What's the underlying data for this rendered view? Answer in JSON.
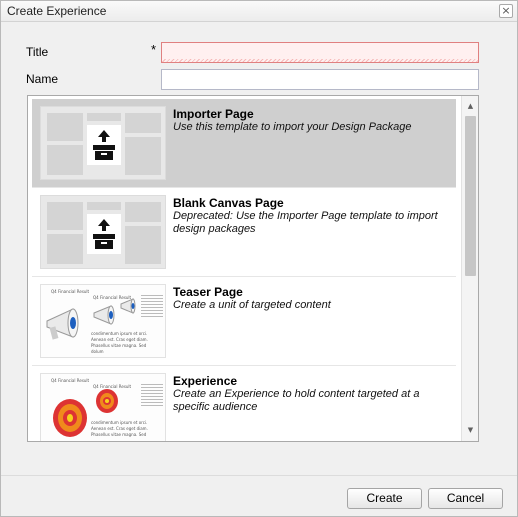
{
  "dialog": {
    "title": "Create Experience",
    "close_glyph": "×"
  },
  "form": {
    "title_label": "Title",
    "required_marker": "*",
    "title_value": "",
    "name_label": "Name",
    "name_value": ""
  },
  "templates": [
    {
      "title": "Importer Page",
      "description": "Use this template to import your Design Package",
      "selected": true,
      "icon": "upload-box-icon"
    },
    {
      "title": "Blank Canvas Page",
      "description": "Deprecated: Use the Importer Page template to import design packages",
      "selected": false,
      "icon": "upload-box-icon"
    },
    {
      "title": "Teaser Page",
      "description": "Create a unit of targeted content",
      "selected": false,
      "icon": "megaphone-icon"
    },
    {
      "title": "Experience",
      "description": "Create an Experience to hold content targeted at a specific audience",
      "selected": false,
      "icon": "target-icon"
    }
  ],
  "thumb_text": {
    "heading": "Q4 Financial Result",
    "caption_line1": "condimentum ipsum et orci.",
    "caption_line2": "Aenean est. Cras eget diam.",
    "caption_line3": "Phasellus vitae magna. Sed",
    "caption_line4": "dolum"
  },
  "buttons": {
    "create": "Create",
    "cancel": "Cancel"
  },
  "colors": {
    "selected_row": "#cfcfcf",
    "invalid_field": "#e08080"
  }
}
